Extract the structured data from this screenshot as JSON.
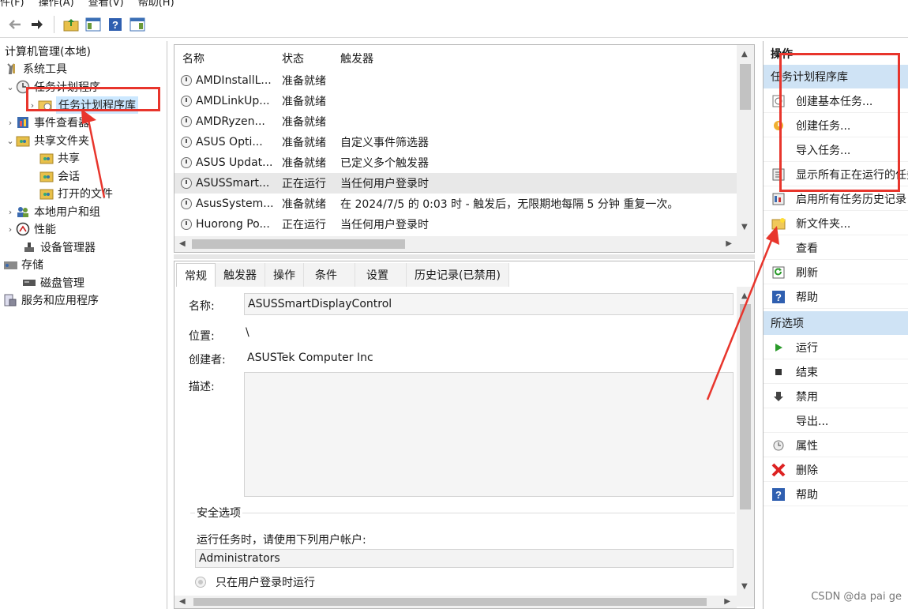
{
  "menu": [
    "件(F)",
    "操作(A)",
    "查看(V)",
    "帮助(H)"
  ],
  "toolbar_icons": [
    "back-arrow-icon",
    "forward-arrow-icon",
    "up-folder-icon",
    "show-hide-tree-icon",
    "help-icon",
    "show-hide-action-pane-icon"
  ],
  "tree": {
    "root": "计算机管理(本地)",
    "system_tools": "系统工具",
    "task_scheduler": "任务计划程序",
    "task_library": "任务计划程序库",
    "event_viewer": "事件查看器",
    "shared_folders": "共享文件夹",
    "shares": "共享",
    "sessions": "会话",
    "open_files": "打开的文件",
    "local_users": "本地用户和组",
    "performance": "性能",
    "device_manager": "设备管理器",
    "storage": "存储",
    "disk_management": "磁盘管理",
    "services_apps": "服务和应用程序"
  },
  "task_list": {
    "columns": [
      "名称",
      "状态",
      "触发器"
    ],
    "rows": [
      {
        "name": "AMDInstallL...",
        "status": "准备就绪",
        "trigger": ""
      },
      {
        "name": "AMDLinkUp...",
        "status": "准备就绪",
        "trigger": ""
      },
      {
        "name": "AMDRyzen...",
        "status": "准备就绪",
        "trigger": ""
      },
      {
        "name": "ASUS Opti...",
        "status": "准备就绪",
        "trigger": "自定义事件筛选器"
      },
      {
        "name": "ASUS Updat...",
        "status": "准备就绪",
        "trigger": "已定义多个触发器"
      },
      {
        "name": "ASUSSmart...",
        "status": "正在运行",
        "trigger": "当任何用户登录时"
      },
      {
        "name": "AsusSystem...",
        "status": "准备就绪",
        "trigger": "在 2024/7/5 的 0:03 时 - 触发后，无限期地每隔 5 分钟 重复一次。"
      },
      {
        "name": "Huorong Po...",
        "status": "正在运行",
        "trigger": "当任何用户登录时"
      }
    ],
    "selected_index": 5
  },
  "details": {
    "tabs": [
      "常规",
      "触发器",
      "操作",
      "条件",
      "设置",
      "历史记录(已禁用)"
    ],
    "name_label": "名称:",
    "name_value": "ASUSSmartDisplayControl",
    "location_label": "位置:",
    "location_value": "\\",
    "author_label": "创建者:",
    "author_value": "ASUSTek Computer Inc",
    "description_label": "描述:",
    "description_value": "",
    "security_title": "安全选项",
    "run_as_text": "运行任务时，请使用下列用户帐户:",
    "run_as_user": "Administrators",
    "only_when_logged_on": "只在用户登录时运行"
  },
  "actions": {
    "title": "操作",
    "section1": "任务计划程序库",
    "items1": [
      {
        "label": "创建基本任务...",
        "icon": "create-basic-task-icon"
      },
      {
        "label": "创建任务...",
        "icon": "create-task-icon"
      },
      {
        "label": "导入任务...",
        "icon": ""
      },
      {
        "label": "显示所有正在运行的任务",
        "icon": "running-tasks-icon"
      },
      {
        "label": "启用所有任务历史记录",
        "icon": "history-icon"
      },
      {
        "label": "新文件夹...",
        "icon": "new-folder-icon"
      },
      {
        "label": "查看",
        "icon": ""
      },
      {
        "label": "刷新",
        "icon": "refresh-icon"
      },
      {
        "label": "帮助",
        "icon": "help-icon"
      }
    ],
    "section2": "所选项",
    "items2": [
      {
        "label": "运行",
        "icon": "run-icon"
      },
      {
        "label": "结束",
        "icon": "end-icon"
      },
      {
        "label": "禁用",
        "icon": "disable-icon"
      },
      {
        "label": "导出...",
        "icon": ""
      },
      {
        "label": "属性",
        "icon": "properties-icon"
      },
      {
        "label": "删除",
        "icon": "delete-icon"
      },
      {
        "label": "帮助",
        "icon": "help-icon"
      }
    ]
  },
  "watermark": "CSDN @da pai ge",
  "annotation_color": "#e8352c",
  "selection_color": "#cce8ff",
  "section_color": "#cfe3f5"
}
